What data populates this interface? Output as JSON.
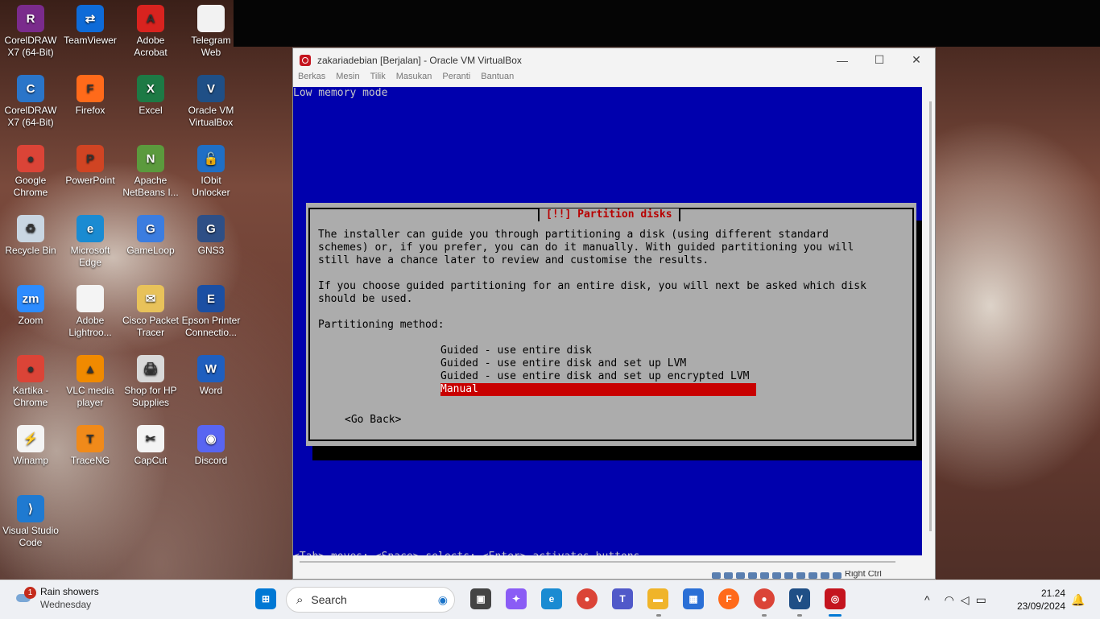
{
  "desktop": {
    "icons": [
      {
        "label": "CorelDRAW X7 (64-Bit)",
        "icon": "winrar-icon",
        "color": "#7a2b8c",
        "glyph": "R"
      },
      {
        "label": "TeamViewer",
        "icon": "teamviewer-icon",
        "color": "#0e6bd8",
        "glyph": "⇄"
      },
      {
        "label": "Adobe Acrobat",
        "icon": "acrobat-icon",
        "color": "#d8231f",
        "glyph": "A"
      },
      {
        "label": "Telegram Web",
        "icon": "file-icon",
        "color": "#f2f2f2",
        "glyph": ""
      },
      {
        "label": "CorelDRAW X7 (64-Bit)",
        "icon": "coreldraw-icon",
        "color": "#2a75c9",
        "glyph": "C"
      },
      {
        "label": "Firefox",
        "icon": "firefox-icon",
        "color": "#ff6a1a",
        "glyph": "F"
      },
      {
        "label": "Excel",
        "icon": "excel-icon",
        "color": "#1d7a45",
        "glyph": "X"
      },
      {
        "label": "Oracle VM VirtualBox",
        "icon": "virtualbox-icon",
        "color": "#1f4f86",
        "glyph": "V"
      },
      {
        "label": "Google Chrome",
        "icon": "chrome-icon",
        "color": "#db4437",
        "glyph": "●"
      },
      {
        "label": "PowerPoint",
        "icon": "powerpoint-icon",
        "color": "#d04423",
        "glyph": "P"
      },
      {
        "label": "Apache NetBeans I...",
        "icon": "netbeans-icon",
        "color": "#5b9a3d",
        "glyph": "N"
      },
      {
        "label": "IObit Unlocker",
        "icon": "unlocker-icon",
        "color": "#1f6fc6",
        "glyph": "🔓"
      },
      {
        "label": "Recycle Bin",
        "icon": "recycle-bin-icon",
        "color": "#c9d6e2",
        "glyph": "♻"
      },
      {
        "label": "Microsoft Edge",
        "icon": "edge-icon",
        "color": "#1a8bd2",
        "glyph": "e"
      },
      {
        "label": "GameLoop",
        "icon": "gameloop-icon",
        "color": "#3b7de0",
        "glyph": "G"
      },
      {
        "label": "GNS3",
        "icon": "gns3-icon",
        "color": "#2e4f86",
        "glyph": "G"
      },
      {
        "label": "Zoom",
        "icon": "zoom-icon",
        "color": "#2d8cff",
        "glyph": "zm"
      },
      {
        "label": "Adobe Lightroo...",
        "icon": "lightroom-icon",
        "color": "#f4f4f4",
        "glyph": ""
      },
      {
        "label": "Cisco Packet Tracer",
        "icon": "packet-tracer-icon",
        "color": "#e8c25a",
        "glyph": "✉"
      },
      {
        "label": "Epson Printer Connectio...",
        "icon": "epson-icon",
        "color": "#1b4fa3",
        "glyph": "E"
      },
      {
        "label": "Kartika - Chrome",
        "icon": "chrome-profile-icon",
        "color": "#db4437",
        "glyph": "●"
      },
      {
        "label": "VLC media player",
        "icon": "vlc-icon",
        "color": "#f08a00",
        "glyph": "▲"
      },
      {
        "label": "Shop for HP Supplies",
        "icon": "hp-shop-icon",
        "color": "#d9d9d9",
        "glyph": "🖨"
      },
      {
        "label": "Word",
        "icon": "word-icon",
        "color": "#1f5fbf",
        "glyph": "W"
      },
      {
        "label": "Winamp",
        "icon": "winamp-icon",
        "color": "#f4f4f4",
        "glyph": "⚡"
      },
      {
        "label": "TraceNG",
        "icon": "traceng-icon",
        "color": "#f08a1a",
        "glyph": "T"
      },
      {
        "label": "CapCut",
        "icon": "capcut-icon",
        "color": "#f4f4f4",
        "glyph": "✂"
      },
      {
        "label": "Discord",
        "icon": "discord-icon",
        "color": "#5865f2",
        "glyph": "◉"
      },
      {
        "label": "Visual Studio Code",
        "icon": "vscode-icon",
        "color": "#1f7ad1",
        "glyph": "⟩"
      }
    ]
  },
  "vm_window": {
    "title": "zakariadebian [Berjalan] - Oracle VM VirtualBox",
    "controls": {
      "minimize": "—",
      "maximize": "☐",
      "close": "✕"
    },
    "menu": [
      "Berkas",
      "Mesin",
      "Tilik",
      "Masukan",
      "Peranti",
      "Bantuan"
    ],
    "status_right": "Right Ctrl"
  },
  "installer": {
    "top_text": "Low memory mode",
    "dialog_title": "[!!] Partition disks",
    "para1": "The installer can guide you through partitioning a disk (using different standard\nschemes) or, if you prefer, you can do it manually. With guided partitioning you will\nstill have a chance later to review and customise the results.",
    "para2": "If you choose guided partitioning for an entire disk, you will next be asked which disk\nshould be used.",
    "method_label": "Partitioning method:",
    "options": [
      "Guided - use entire disk",
      "Guided - use entire disk and set up LVM",
      "Guided - use entire disk and set up encrypted LVM",
      "Manual"
    ],
    "selected_option": "Manual",
    "go_back": "<Go Back>",
    "help_line": "<Tab> moves; <Space> selects; <Enter> activates buttons"
  },
  "taskbar": {
    "weather": {
      "badge": "1",
      "title": "Rain showers",
      "day": "Wednesday"
    },
    "search_placeholder": "Search",
    "time": "21.24",
    "date": "23/09/2024",
    "tray_chevron": "^"
  }
}
